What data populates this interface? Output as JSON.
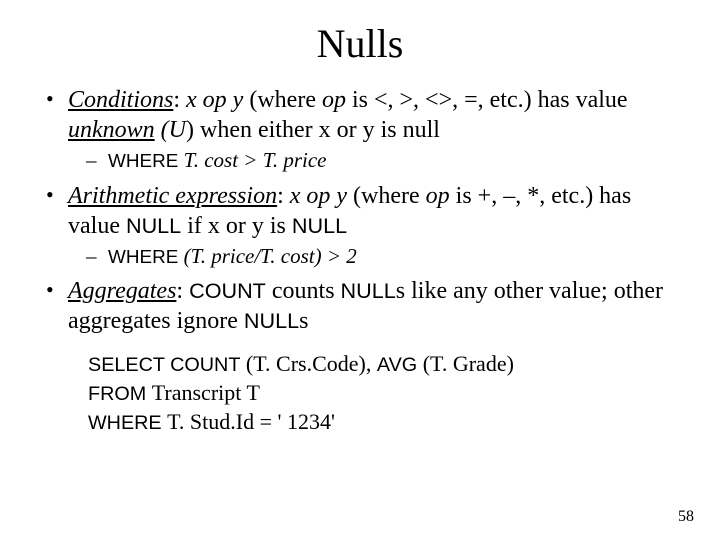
{
  "title": "Nulls",
  "bullets": {
    "b1": {
      "label": "Conditions",
      "expr": "x op y",
      "mid1": "  (where ",
      "op": "op",
      "oplist": " is <, >, <>, =, etc.) has value ",
      "unknown": "unknown",
      "u": " (U",
      "tail": ") when either x or y is null",
      "sub_where": "WHERE ",
      "sub_expr": " T. cost > T. price"
    },
    "b2": {
      "label": "Arithmetic expression",
      "expr": "x op y",
      "mid1": " (where ",
      "op": "op",
      "oplist": " is +, –, *, etc.) has value ",
      "null1": "NULL",
      "mid2": " if x or y is ",
      "null2": "NULL",
      "sub_where": "WHERE ",
      "sub_expr": " (T. price/T. cost) > 2"
    },
    "b3": {
      "label": "Aggregates",
      "colon": ":  ",
      "count": "COUNT",
      "mid1": " counts ",
      "null1": "NULL",
      "mid2": "s like any other value; other aggregates ignore ",
      "null2": "NULL",
      "tail": "s"
    }
  },
  "sql": {
    "l1a": "SELECT  COUNT",
    "l1b": " (T. Crs.Code),  ",
    "l1c": "AVG",
    "l1d": " (T. Grade)",
    "l2a": "FROM   ",
    "l2b": " Transcript T",
    "l3a": "WHERE  ",
    "l3b": " T. Stud.Id = ' 1234'"
  },
  "page": "58"
}
